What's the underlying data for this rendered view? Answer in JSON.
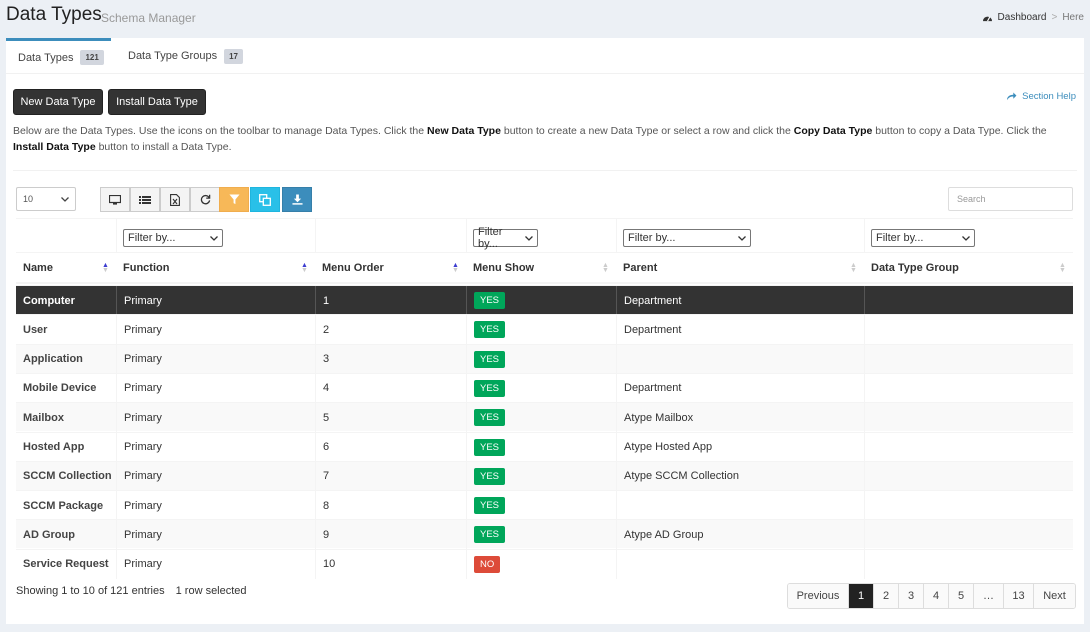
{
  "header": {
    "title": "Data Types",
    "subtitle": "Schema Manager",
    "breadcrumb": [
      "Dashboard",
      "Here"
    ]
  },
  "tabs": [
    {
      "label": "Data Types",
      "count": "121",
      "active": true
    },
    {
      "label": "Data Type Groups",
      "count": "17",
      "active": false
    }
  ],
  "actions": {
    "new_label": "New Data Type",
    "install_label": "Install Data Type",
    "help_label": "Section Help"
  },
  "description": {
    "p1": "Below are the Data Types. Use the icons on the toolbar to manage Data Types. Click the ",
    "b1": "New Data Type",
    "p2": " button to create a new Data Type or select a row and click the ",
    "b2": "Copy Data Type",
    "p3": " button to copy a Data Type. Click the ",
    "b3": "Install Data Type",
    "p4": " button to install a Data Type."
  },
  "toolbar": {
    "page_size": "10",
    "search_placeholder": "Search",
    "buttons": [
      "monitor-icon",
      "list-icon",
      "excel-icon",
      "refresh-icon",
      "filter-icon",
      "copy-icon",
      "download-icon"
    ]
  },
  "filters": {
    "placeholder": "Filter by..."
  },
  "columns": [
    "Name",
    "Function",
    "Menu Order",
    "Menu Show",
    "Parent",
    "Data Type Group"
  ],
  "rows": [
    {
      "name": "Computer",
      "function": "Primary",
      "order": "1",
      "show": "YES",
      "parent": "Department",
      "group": ""
    },
    {
      "name": "User",
      "function": "Primary",
      "order": "2",
      "show": "YES",
      "parent": "Department",
      "group": ""
    },
    {
      "name": "Application",
      "function": "Primary",
      "order": "3",
      "show": "YES",
      "parent": "",
      "group": ""
    },
    {
      "name": "Mobile Device",
      "function": "Primary",
      "order": "4",
      "show": "YES",
      "parent": "Department",
      "group": ""
    },
    {
      "name": "Mailbox",
      "function": "Primary",
      "order": "5",
      "show": "YES",
      "parent": "Atype Mailbox",
      "group": ""
    },
    {
      "name": "Hosted App",
      "function": "Primary",
      "order": "6",
      "show": "YES",
      "parent": "Atype Hosted App",
      "group": ""
    },
    {
      "name": "SCCM Collection",
      "function": "Primary",
      "order": "7",
      "show": "YES",
      "parent": "Atype SCCM Collection",
      "group": ""
    },
    {
      "name": "SCCM Package",
      "function": "Primary",
      "order": "8",
      "show": "YES",
      "parent": "",
      "group": ""
    },
    {
      "name": "AD Group",
      "function": "Primary",
      "order": "9",
      "show": "YES",
      "parent": "Atype AD Group",
      "group": ""
    },
    {
      "name": "Service Request",
      "function": "Primary",
      "order": "10",
      "show": "NO",
      "parent": "",
      "group": ""
    }
  ],
  "selected_row": 0,
  "footer": {
    "info": "Showing 1 to 10 of 121 entries",
    "selection": "1 row selected"
  },
  "pagination": [
    "Previous",
    "1",
    "2",
    "3",
    "4",
    "5",
    "…",
    "13",
    "Next"
  ],
  "active_page": "1",
  "colors": {
    "yes": "#00a65a",
    "no": "#dd4b39",
    "accent": "#3c8dbc",
    "filter_button": "#f7b858",
    "copy_button": "#29c0e8",
    "download_button": "#3c8dbc"
  }
}
